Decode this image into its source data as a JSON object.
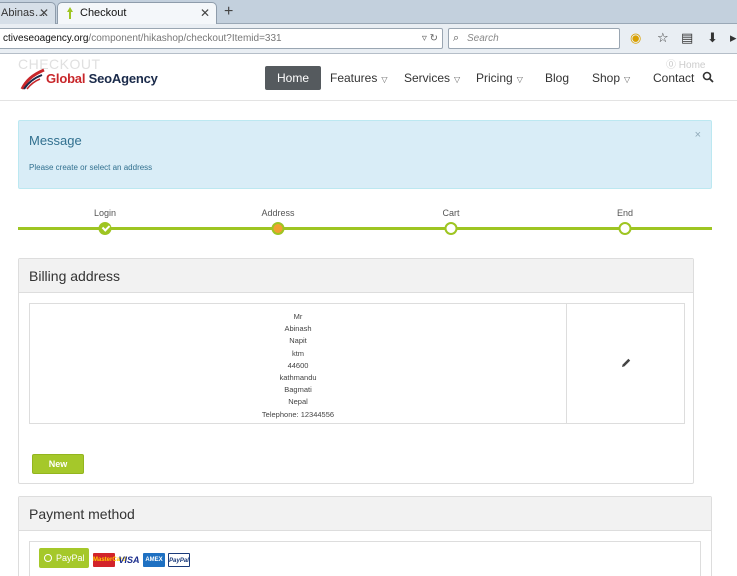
{
  "browser": {
    "tabs": [
      {
        "label": "Abinas…",
        "active": false
      },
      {
        "label": "Checkout",
        "active": true
      }
    ],
    "url_prefix": "ctiveseoagency.org",
    "url_path": "/component/hikashop/checkout?Itemid=331",
    "search_placeholder": "Search"
  },
  "site": {
    "ghost_title": "CHECKOUT",
    "ghost_home": "Home",
    "logo_part1": "Global ",
    "logo_part2": "SeoAgency",
    "menu": [
      {
        "label": "Home",
        "active": true,
        "dropdown": false
      },
      {
        "label": "Features",
        "active": false,
        "dropdown": true
      },
      {
        "label": "Services",
        "active": false,
        "dropdown": true
      },
      {
        "label": "Pricing",
        "active": false,
        "dropdown": true
      },
      {
        "label": "Blog",
        "active": false,
        "dropdown": false
      },
      {
        "label": "Shop",
        "active": false,
        "dropdown": true
      },
      {
        "label": "Contact",
        "active": false,
        "dropdown": false
      }
    ]
  },
  "message": {
    "title": "Message",
    "text": "Please create or select an address",
    "close": "×"
  },
  "steps": [
    {
      "label": "Login",
      "state": "done"
    },
    {
      "label": "Address",
      "state": "current"
    },
    {
      "label": "Cart",
      "state": "todo"
    },
    {
      "label": "End",
      "state": "todo"
    }
  ],
  "billing": {
    "title": "Billing address",
    "address_lines": [
      "Mr",
      "Abinash",
      "Napit",
      "ktm",
      "44600",
      "kathmandu",
      "Bagmati",
      "Nepal",
      "Telephone: 12344556"
    ],
    "new_button": "New"
  },
  "payment": {
    "title": "Payment method",
    "paypal_label": "PayPal",
    "cards": [
      "MasterCard",
      "VISA",
      "AMEX",
      "PayPal"
    ]
  },
  "colors": {
    "accent_green": "#a5c82a",
    "info_bg": "#d9edf7",
    "info_text": "#31708f",
    "menu_active": "#555a5e"
  }
}
